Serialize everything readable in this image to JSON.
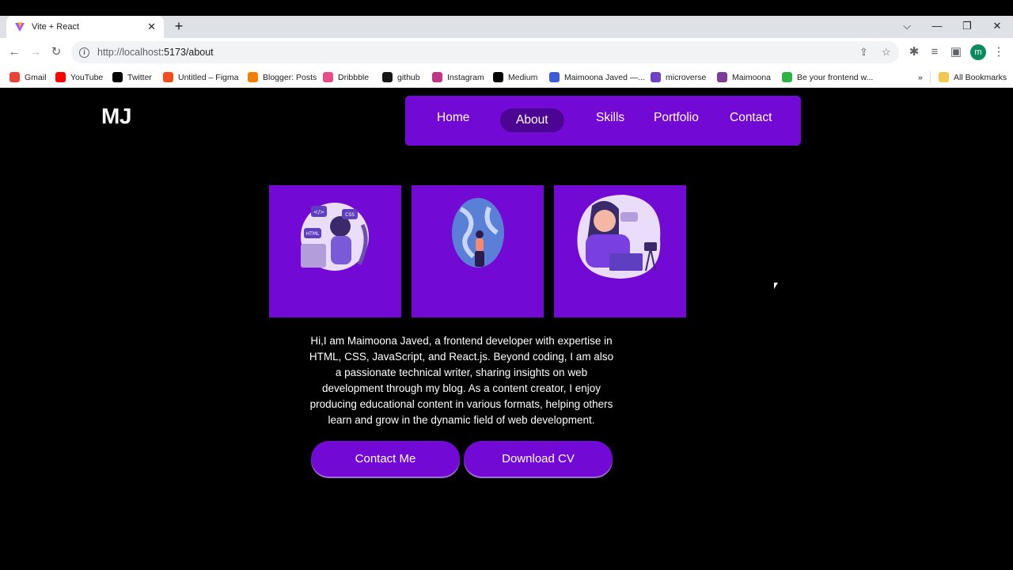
{
  "browser": {
    "tab_title": "Vite + React",
    "url_host": "http://localhost",
    "url_rest": ":5173/about",
    "avatar_letter": "m",
    "bookmarks": [
      {
        "label": "Gmail",
        "color": "#ea4335",
        "icon": "gmail-icon"
      },
      {
        "label": "YouTube",
        "color": "#ff0000",
        "icon": "youtube-icon"
      },
      {
        "label": "Twitter",
        "color": "#000000",
        "icon": "x-icon"
      },
      {
        "label": "Untitled – Figma",
        "color": "#f24e1e",
        "icon": "figma-icon"
      },
      {
        "label": "Blogger: Posts",
        "color": "#f57d00",
        "icon": "blogger-icon"
      },
      {
        "label": "Dribbble",
        "color": "#ea4c89",
        "icon": "dribbble-icon"
      },
      {
        "label": "github",
        "color": "#181717",
        "icon": "github-icon"
      },
      {
        "label": "Instagram",
        "color": "#c13584",
        "icon": "instagram-icon"
      },
      {
        "label": "Medium",
        "color": "#000000",
        "icon": "medium-icon"
      },
      {
        "label": "Maimoona Javed —...",
        "color": "#3b5bdb",
        "icon": "diamond-icon"
      },
      {
        "label": "microverse",
        "color": "#6f42c1",
        "icon": "microverse-icon"
      },
      {
        "label": "Maimoona",
        "color": "#7d3c98",
        "icon": "user-icon"
      },
      {
        "label": "Be your frontend w...",
        "color": "#2fb344",
        "icon": "hashnode-icon"
      }
    ],
    "all_bookmarks": "All Bookmarks",
    "overflow": "»"
  },
  "site": {
    "logo": "MJ",
    "nav": [
      "Home",
      "About",
      "Skills",
      "Portfolio",
      "Contact"
    ],
    "active_nav": "About",
    "accent": "#7209d4",
    "about_text": "Hi,I am Maimoona Javed, a frontend developer with expertise in HTML, CSS, JavaScript, and React.js. Beyond coding, I am also a passionate technical writer, sharing insights on web development through my blog. As a content creator, I enjoy producing educational content in various formats, helping others learn and grow in the dynamic field of web development.",
    "contact_btn": "Contact Me",
    "cv_btn": "Download CV",
    "card1_tags": {
      "code": "</>",
      "css": "CSS",
      "html": "HTML"
    }
  }
}
